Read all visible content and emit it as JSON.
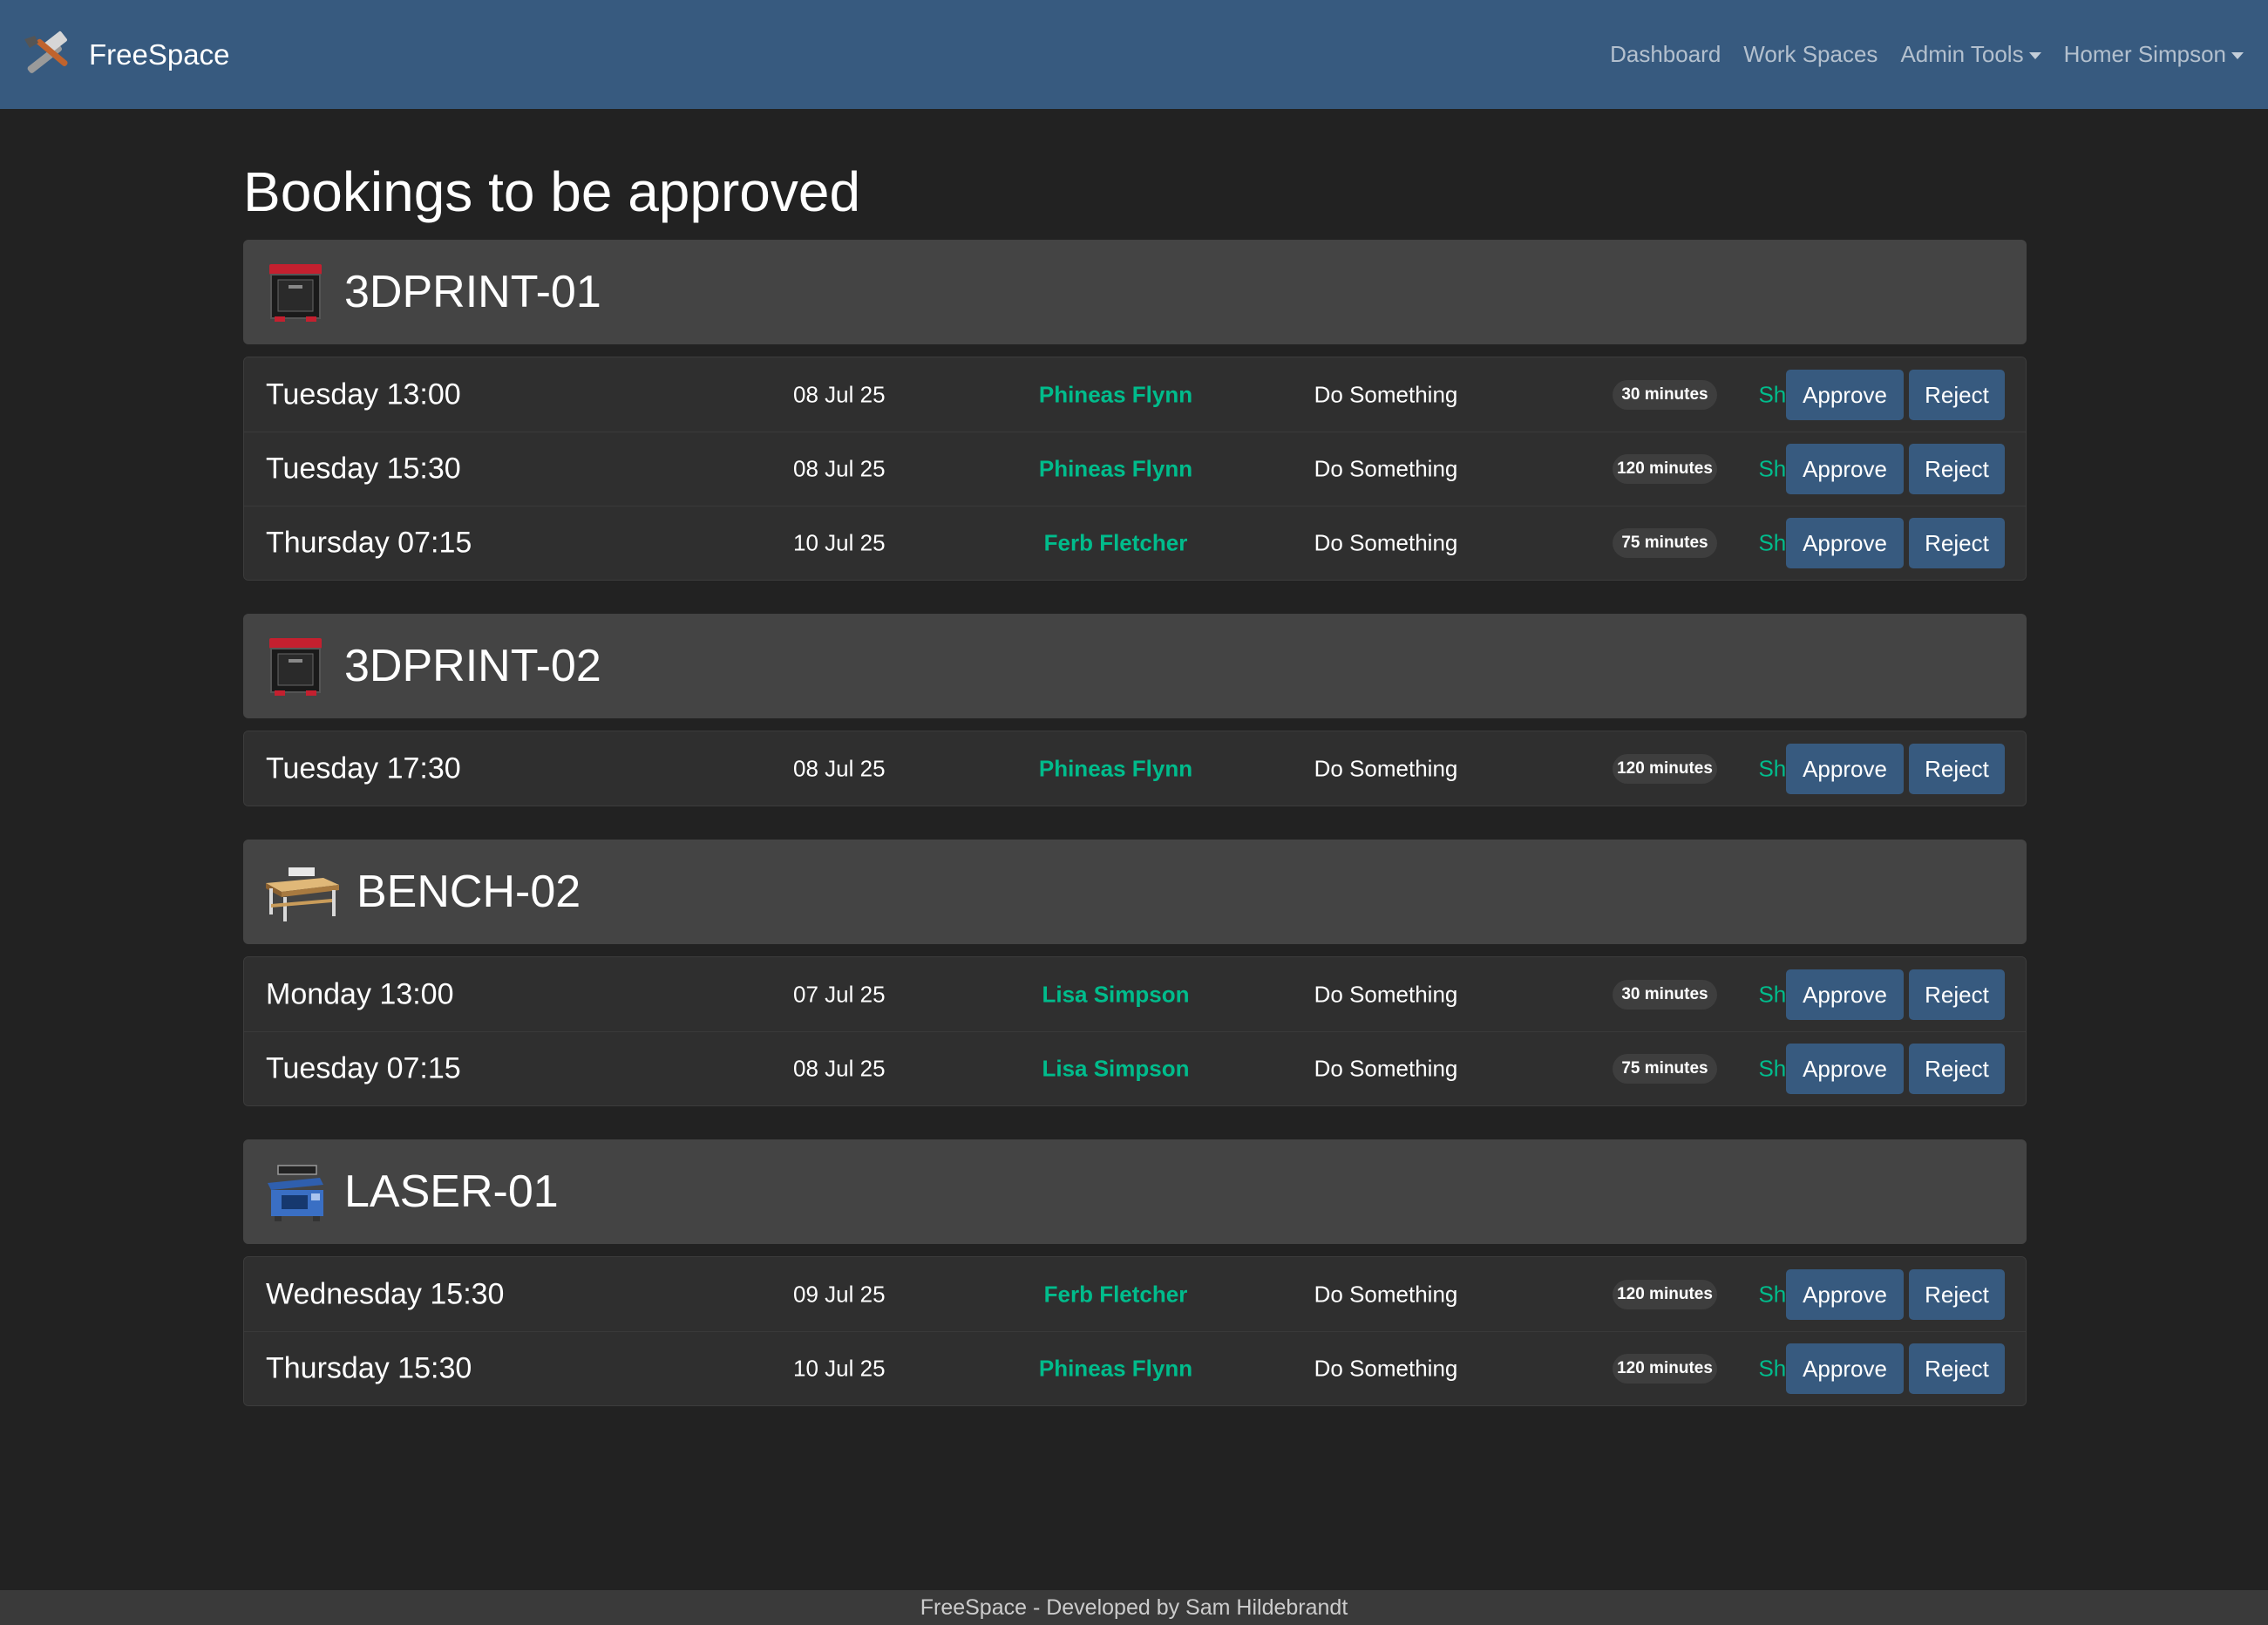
{
  "navbar": {
    "brand": "FreeSpace",
    "links": {
      "dashboard": "Dashboard",
      "workspaces": "Work Spaces",
      "admin": "Admin Tools",
      "user": "Homer Simpson"
    }
  },
  "page": {
    "title": "Bookings to be approved"
  },
  "buttons": {
    "approve": "Approve",
    "reject": "Reject",
    "show": "Show"
  },
  "groups": [
    {
      "name": "3DPRINT-01",
      "icon": "3d-printer-icon",
      "bookings": [
        {
          "day": "Tuesday 13:00",
          "date": "08 Jul 25",
          "user": "Phineas Flynn",
          "task": "Do Something",
          "duration": "30 minutes"
        },
        {
          "day": "Tuesday 15:30",
          "date": "08 Jul 25",
          "user": "Phineas Flynn",
          "task": "Do Something",
          "duration": "120 minutes"
        },
        {
          "day": "Thursday 07:15",
          "date": "10 Jul 25",
          "user": "Ferb Fletcher",
          "task": "Do Something",
          "duration": "75 minutes"
        }
      ]
    },
    {
      "name": "3DPRINT-02",
      "icon": "3d-printer-icon",
      "bookings": [
        {
          "day": "Tuesday 17:30",
          "date": "08 Jul 25",
          "user": "Phineas Flynn",
          "task": "Do Something",
          "duration": "120 minutes"
        }
      ]
    },
    {
      "name": "BENCH-02",
      "icon": "workbench-icon",
      "bookings": [
        {
          "day": "Monday 13:00",
          "date": "07 Jul 25",
          "user": "Lisa Simpson",
          "task": "Do Something",
          "duration": "30 minutes"
        },
        {
          "day": "Tuesday 07:15",
          "date": "08 Jul 25",
          "user": "Lisa Simpson",
          "task": "Do Something",
          "duration": "75 minutes"
        }
      ]
    },
    {
      "name": "LASER-01",
      "icon": "laser-cutter-icon",
      "bookings": [
        {
          "day": "Wednesday 15:30",
          "date": "09 Jul 25",
          "user": "Ferb Fletcher",
          "task": "Do Something",
          "duration": "120 minutes"
        },
        {
          "day": "Thursday 15:30",
          "date": "10 Jul 25",
          "user": "Phineas Flynn",
          "task": "Do Something",
          "duration": "120 minutes"
        }
      ]
    }
  ],
  "footer": {
    "text": "FreeSpace - Developed by Sam Hildebrandt"
  },
  "colors": {
    "navbar": "#375a7f",
    "background": "#222222",
    "accent_green": "#00bc8c",
    "button": "#375a7f",
    "header_panel": "#444444"
  }
}
